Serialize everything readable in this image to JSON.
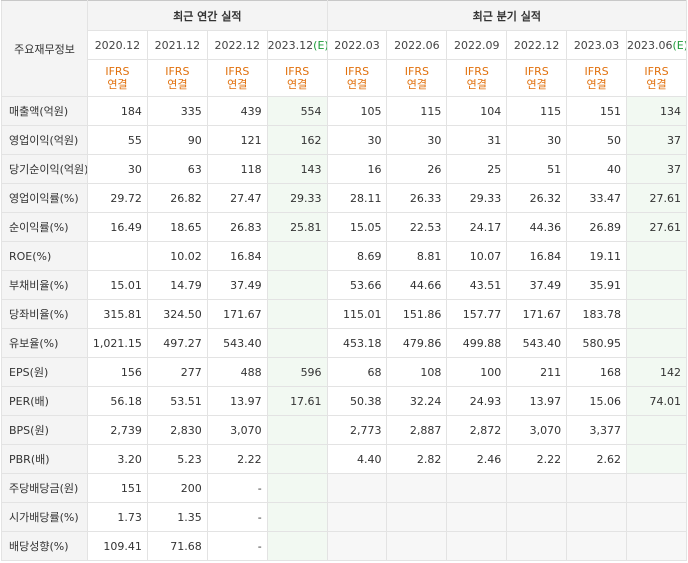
{
  "corner_label": "주요재무정보",
  "group_annual": "최근 연간 실적",
  "group_quarter": "최근 분기 실적",
  "periods": [
    {
      "label": "2020.12",
      "est": ""
    },
    {
      "label": "2021.12",
      "est": ""
    },
    {
      "label": "2022.12",
      "est": ""
    },
    {
      "label": "2023.12",
      "est": "(E)"
    },
    {
      "label": "2022.03",
      "est": ""
    },
    {
      "label": "2022.06",
      "est": ""
    },
    {
      "label": "2022.09",
      "est": ""
    },
    {
      "label": "2022.12",
      "est": ""
    },
    {
      "label": "2023.03",
      "est": ""
    },
    {
      "label": "2023.06",
      "est": "(E)"
    }
  ],
  "ifrs_line1": "IFRS",
  "ifrs_line2": "연결",
  "rows": [
    {
      "label": "매출액(억원)",
      "values": [
        "184",
        "335",
        "439",
        "554",
        "105",
        "115",
        "104",
        "115",
        "151",
        "134"
      ]
    },
    {
      "label": "영업이익(억원)",
      "values": [
        "55",
        "90",
        "121",
        "162",
        "30",
        "30",
        "31",
        "30",
        "50",
        "37"
      ]
    },
    {
      "label": "당기순이익(억원)",
      "values": [
        "30",
        "63",
        "118",
        "143",
        "16",
        "26",
        "25",
        "51",
        "40",
        "37"
      ]
    },
    {
      "label": "영업이익률(%)",
      "values": [
        "29.72",
        "26.82",
        "27.47",
        "29.33",
        "28.11",
        "26.33",
        "29.33",
        "26.32",
        "33.47",
        "27.61"
      ]
    },
    {
      "label": "순이익률(%)",
      "values": [
        "16.49",
        "18.65",
        "26.83",
        "25.81",
        "15.05",
        "22.53",
        "24.17",
        "44.36",
        "26.89",
        "27.61"
      ]
    },
    {
      "label": "ROE(%)",
      "values": [
        "",
        "10.02",
        "16.84",
        "",
        "8.69",
        "8.81",
        "10.07",
        "16.84",
        "19.11",
        ""
      ]
    },
    {
      "label": "부채비율(%)",
      "values": [
        "15.01",
        "14.79",
        "37.49",
        "",
        "53.66",
        "44.66",
        "43.51",
        "37.49",
        "35.91",
        ""
      ]
    },
    {
      "label": "당좌비율(%)",
      "values": [
        "315.81",
        "324.50",
        "171.67",
        "",
        "115.01",
        "151.86",
        "157.77",
        "171.67",
        "183.78",
        ""
      ]
    },
    {
      "label": "유보율(%)",
      "values": [
        "1,021.15",
        "497.27",
        "543.40",
        "",
        "453.18",
        "479.86",
        "499.88",
        "543.40",
        "580.95",
        ""
      ]
    },
    {
      "label": "EPS(원)",
      "values": [
        "156",
        "277",
        "488",
        "596",
        "68",
        "108",
        "100",
        "211",
        "168",
        "142"
      ]
    },
    {
      "label": "PER(배)",
      "values": [
        "56.18",
        "53.51",
        "13.97",
        "17.61",
        "50.38",
        "32.24",
        "24.93",
        "13.97",
        "15.06",
        "74.01"
      ]
    },
    {
      "label": "BPS(원)",
      "values": [
        "2,739",
        "2,830",
        "3,070",
        "",
        "2,773",
        "2,887",
        "2,872",
        "3,070",
        "3,377",
        ""
      ]
    },
    {
      "label": "PBR(배)",
      "values": [
        "3.20",
        "5.23",
        "2.22",
        "",
        "4.40",
        "2.82",
        "2.46",
        "2.22",
        "2.62",
        ""
      ]
    },
    {
      "label": "주당배당금(원)",
      "values": [
        "151",
        "200",
        "-",
        "",
        "",
        "",
        "",
        "",
        "",
        ""
      ]
    },
    {
      "label": "시가배당률(%)",
      "values": [
        "1.73",
        "1.35",
        "-",
        "",
        "",
        "",
        "",
        "",
        "",
        ""
      ]
    },
    {
      "label": "배당성향(%)",
      "values": [
        "109.41",
        "71.68",
        "-",
        "",
        "",
        "",
        "",
        "",
        "",
        ""
      ]
    }
  ]
}
